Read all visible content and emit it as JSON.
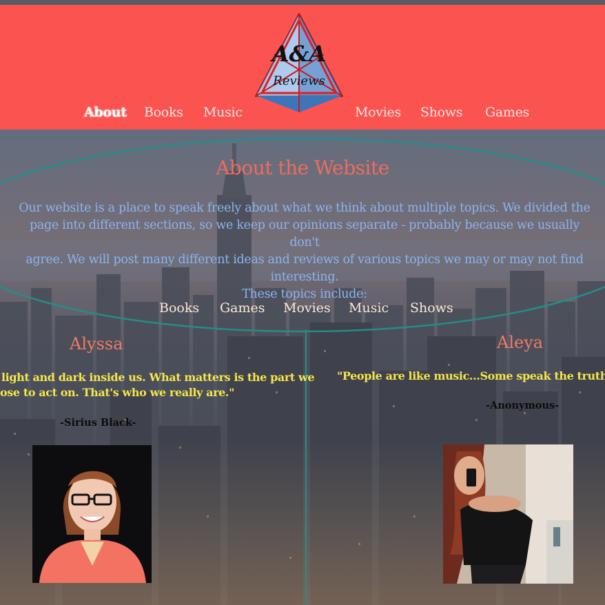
{
  "brand": {
    "logo_top": "A&A",
    "logo_bottom": "Reviews"
  },
  "nav": {
    "items": [
      {
        "label": "About",
        "active": true
      },
      {
        "label": "Books"
      },
      {
        "label": "Music"
      },
      {
        "label": "Movies"
      },
      {
        "label": "Shows"
      },
      {
        "label": "Games"
      }
    ]
  },
  "about": {
    "title": "About the Website",
    "intro_lines": [
      "Our website is a place to speak freely about what we think about multiple topics. We divided the",
      "page into different sections, so we keep our opinions separate - probably because we usually don't",
      "agree. We will post many different ideas and reviews of various topics we may or may not find",
      "interesting.",
      "These topics include:"
    ],
    "topics": [
      "Books",
      "Games",
      "Movies",
      "Music",
      "Shows"
    ]
  },
  "authors": {
    "left": {
      "name": "Alyssa",
      "quote_line1": "light and dark inside us. What matters is the part we",
      "quote_line2": "ose to act on. That's who we really are.\"",
      "attribution": "-Sirius Black-"
    },
    "right": {
      "name": "Aleya",
      "quote_line1": "\"People are like music...Some speak the truth...othe",
      "attribution": "-Anonymous-"
    }
  },
  "colors": {
    "header_bg": "#fb5350",
    "title": "#f26b5b",
    "intro_text": "#8ab4f2",
    "quote": "#f6e64a",
    "accent_line": "#18a79b"
  }
}
